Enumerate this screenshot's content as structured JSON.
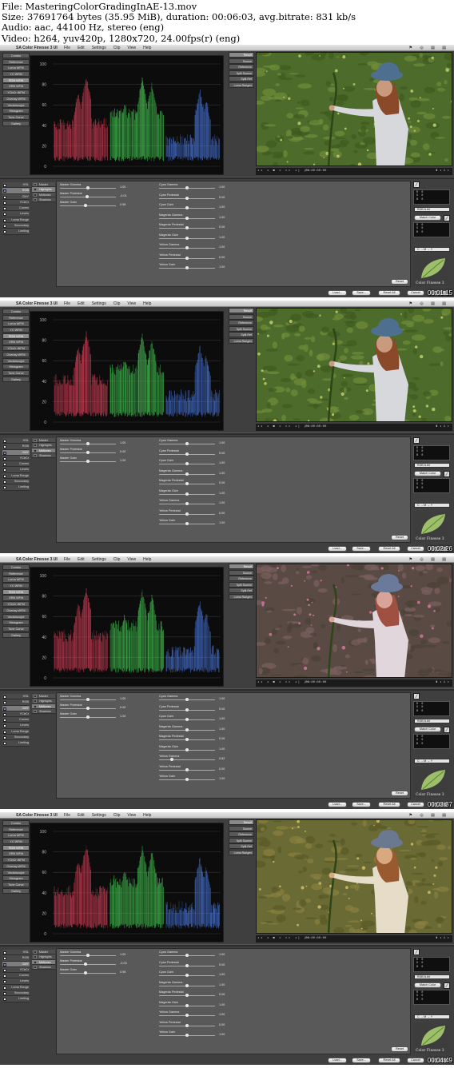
{
  "header": {
    "file": "File: MasteringColorGradingInAE-13.mov",
    "size": "Size: 37691764 bytes (35.95 MiB), duration: 00:06:03, avg.bitrate: 831 kb/s",
    "audio": "Audio: aac, 44100 Hz, stereo (eng)",
    "video": "Video: h264, yuv420p, 1280x720, 24.00fps(r) (eng)"
  },
  "menubar": {
    "apple": "",
    "app_name": "SA Color Finesse 3 UI",
    "items": [
      "File",
      "Edit",
      "Settings",
      "Clip",
      "View",
      "Help"
    ],
    "status": "⚑ ◎ ▤ ▤"
  },
  "scope_nav": [
    "Combo",
    "Reference",
    "Luma WFM",
    "YC WFM",
    "RGB WFM",
    "GRB WFM",
    "YCbCr WFM",
    "Overlay WFM",
    "Vectorscope",
    "Histogram",
    "Tone Curve",
    "Gallery"
  ],
  "view_nav": [
    "Result",
    "Source",
    "Reference",
    "Split Source",
    "Split Ref",
    "Luma Ranges"
  ],
  "scope_labels": [
    "100",
    "80",
    "60",
    "40",
    "20",
    "0"
  ],
  "transport": {
    "buttons": "◂◂ ◂ ■ ▸ ▸▸ ◂| |▸",
    "timecode": "00:00:00:00",
    "zoom": "▮ ◂ 1 ▸"
  },
  "corrections": [
    "HSL",
    "RGB",
    "CMY",
    "YCbCr",
    "Curves",
    "Levels",
    "Luma Range",
    "Secondary",
    "Limiting"
  ],
  "tonal": [
    "Master",
    "Highlights",
    "Midtones",
    "Shadows"
  ],
  "left_sliders": [
    "Master Gamma",
    "Master Pedestal",
    "Master Gain"
  ],
  "right_sliders": [
    "Cyan Gamma",
    "Cyan Pedestal",
    "Cyan Gain",
    "Magenta Gamma",
    "Magenta Pedestal",
    "Magenta Gain",
    "Yellow Gamma",
    "Yellow Pedestal",
    "Yellow Gain"
  ],
  "side_panel": {
    "readout": "R  0\nG  0\nB  0",
    "dropdown1": "RGB 8-bit",
    "match_color": "Match Color",
    "dropdown2": "C → M → Y",
    "logo_text": "Color Finesse 3"
  },
  "buttons": {
    "reset": "Reset",
    "load": "Load...",
    "save": "Save...",
    "reset_all": "Reset All",
    "cancel": "Cancel",
    "ok": "OK"
  },
  "frames": [
    {
      "app_name": "SA Color Finesse 3 UI",
      "active_scope": 4,
      "active_correction": 1,
      "checked": [
        1
      ],
      "active_view": 0,
      "tonal_active": 1,
      "left_values": [
        "1.00",
        "-0.01",
        "0.96"
      ],
      "left_knobs": [
        0.5,
        0.48,
        0.45
      ],
      "right_values": [
        "1.00",
        "0.00",
        "1.00",
        "1.00",
        "0.00",
        "1.00",
        "1.00",
        "0.00",
        "1.00"
      ],
      "right_knobs": [
        0.5,
        0.5,
        0.5,
        0.5,
        0.5,
        0.5,
        0.5,
        0.5,
        0.5
      ],
      "timestamp": "00:01:15",
      "grade": "natural"
    },
    {
      "app_name": "SA Color Finesse 3 UI",
      "active_scope": 4,
      "active_correction": 2,
      "checked": [
        2
      ],
      "active_view": 0,
      "tonal_active": 2,
      "left_values": [
        "1.00",
        "0.00",
        "1.00"
      ],
      "left_knobs": [
        0.5,
        0.5,
        0.5
      ],
      "right_values": [
        "1.00",
        "0.00",
        "1.00",
        "1.00",
        "0.00",
        "1.00",
        "1.00",
        "0.00",
        "1.00"
      ],
      "right_knobs": [
        0.5,
        0.5,
        0.5,
        0.5,
        0.5,
        0.5,
        0.5,
        0.5,
        0.5
      ],
      "timestamp": "00:02:26",
      "grade": "natural"
    },
    {
      "app_name": "SA Color Finesse 3 UI",
      "active_scope": 4,
      "active_correction": 2,
      "checked": [
        2
      ],
      "active_view": 0,
      "tonal_active": 2,
      "left_values": [
        "1.00",
        "0.00",
        "1.00"
      ],
      "left_knobs": [
        0.5,
        0.5,
        0.5
      ],
      "right_values": [
        "1.00",
        "0.00",
        "1.00",
        "1.00",
        "0.00",
        "1.00",
        "0.82",
        "0.00",
        "1.00"
      ],
      "right_knobs": [
        0.5,
        0.5,
        0.5,
        0.5,
        0.5,
        0.5,
        0.23,
        0.5,
        0.5
      ],
      "timestamp": "00:03:37",
      "grade": "magenta"
    },
    {
      "app_name": "SA Color Finesse 3 UI",
      "active_scope": 4,
      "active_correction": 2,
      "checked": [
        2
      ],
      "active_view": 0,
      "tonal_active": 2,
      "left_values": [
        "1.00",
        "-0.03",
        "0.96"
      ],
      "left_knobs": [
        0.5,
        0.46,
        0.45
      ],
      "right_values": [
        "1.00",
        "0.00",
        "1.00",
        "1.00",
        "0.00",
        "1.00",
        "1.00",
        "0.00",
        "1.00"
      ],
      "right_knobs": [
        0.5,
        0.5,
        0.5,
        0.5,
        0.5,
        0.5,
        0.5,
        0.5,
        0.5
      ],
      "timestamp": "00:04:49",
      "grade": "warm"
    }
  ]
}
